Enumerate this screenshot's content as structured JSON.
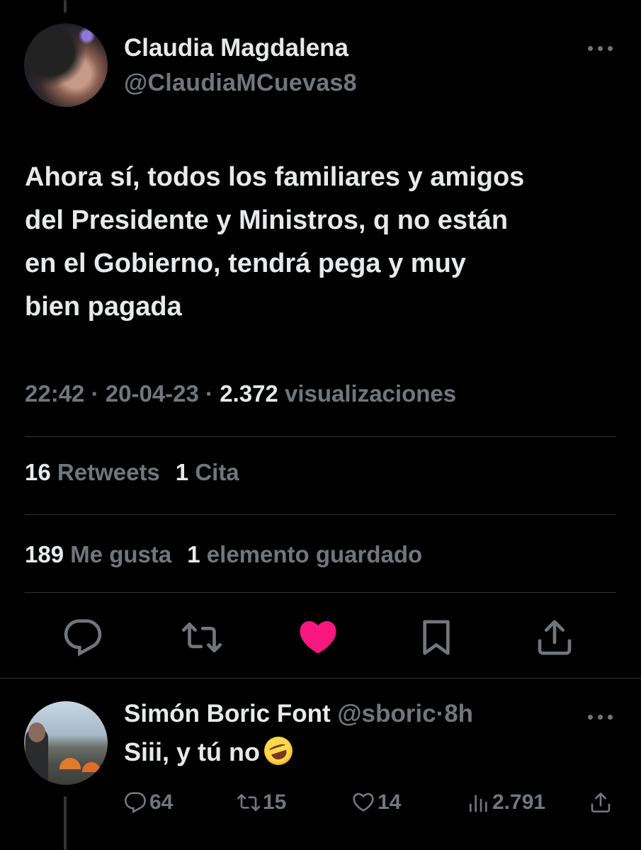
{
  "tweet": {
    "author_name": "Claudia Magdalena",
    "author_handle": "@ClaudiaMCuevas8",
    "text": "Ahora sí, todos los familiares y amigos\ndel Presidente y Ministros, q no están\nen el Gobierno, tendrá pega y muy\nbien pagada",
    "time": "22:42",
    "date": "20-04-23",
    "views_count": "2.372",
    "views_label": "visualizaciones",
    "separator": "·",
    "retweets_count": "16",
    "retweets_label": "Retweets",
    "quotes_count": "1",
    "quotes_label": "Cita",
    "likes_count": "189",
    "likes_label": "Me gusta",
    "bookmarks_count": "1",
    "bookmarks_label": "elemento guardado",
    "liked": true,
    "like_color": "#f91880"
  },
  "reply": {
    "author_name": "Simón Boric Font",
    "author_handle": "@sboric",
    "separator": "·",
    "age": "8h",
    "text": "Siii, y tú no",
    "emoji": "rolling-on-floor-laughing",
    "replies": "64",
    "retweets": "15",
    "likes": "14",
    "views": "2.791"
  },
  "colors": {
    "background": "#000000",
    "text": "#e7e9ea",
    "muted": "#71767b",
    "divider": "#2f3336"
  },
  "icons": [
    "more-icon",
    "reply-icon",
    "retweet-icon",
    "heart-icon",
    "bookmark-icon",
    "share-icon",
    "views-icon"
  ]
}
